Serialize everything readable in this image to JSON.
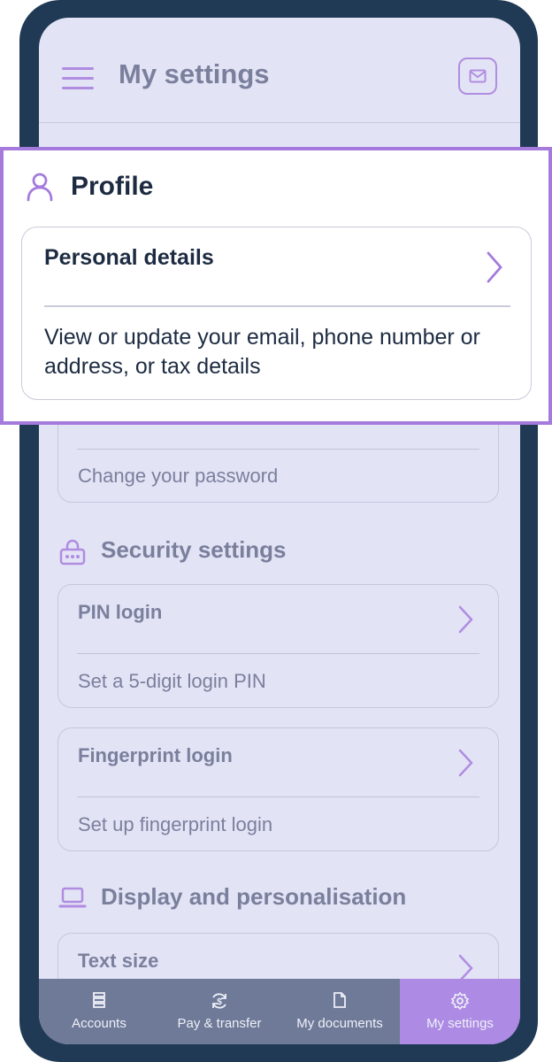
{
  "header": {
    "title": "My settings",
    "menu_icon": "hamburger-menu-icon",
    "mail_icon": "mail-icon"
  },
  "account_card": {
    "description": "Change your password"
  },
  "security": {
    "title": "Security settings",
    "icon": "lock-keypad-icon",
    "items": [
      {
        "title": "PIN login",
        "description": "Set a 5-digit login PIN"
      },
      {
        "title": "Fingerprint login",
        "description": "Set up fingerprint login"
      }
    ]
  },
  "display": {
    "title": "Display and personalisation",
    "icon": "laptop-icon",
    "items": [
      {
        "title": "Text size"
      }
    ]
  },
  "profile": {
    "title": "Profile",
    "icon": "person-icon",
    "card": {
      "title": "Personal details",
      "description": "View or update your email, phone number or address, or tax details"
    }
  },
  "nav": {
    "items": [
      {
        "label": "Accounts",
        "icon": "accounts-icon"
      },
      {
        "label": "Pay & transfer",
        "icon": "transfer-icon"
      },
      {
        "label": "My documents",
        "icon": "document-icon"
      },
      {
        "label": "My settings",
        "icon": "gear-icon",
        "active": true
      }
    ]
  },
  "colors": {
    "accent": "#a47bdc",
    "phone_frame": "#203a55",
    "nav_bg": "#6f7a98",
    "text_dark": "#1d2b42"
  }
}
